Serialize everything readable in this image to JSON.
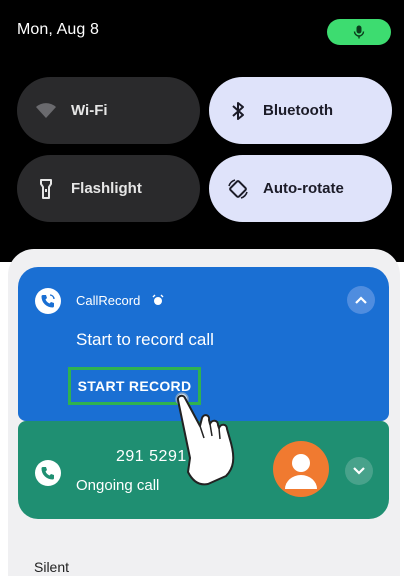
{
  "status": {
    "date": "Mon, Aug 8",
    "mic_icon": "mic-icon",
    "mic_color": "#3ddc70"
  },
  "quick_settings": [
    {
      "label": "Wi-Fi",
      "icon": "wifi-icon",
      "state": "off"
    },
    {
      "label": "Bluetooth",
      "icon": "bluetooth-icon",
      "state": "on"
    },
    {
      "label": "Flashlight",
      "icon": "flashlight-icon",
      "state": "off"
    },
    {
      "label": "Auto-rotate",
      "icon": "auto-rotate-icon",
      "state": "on"
    }
  ],
  "record_notification": {
    "app_name": "CallRecord",
    "title": "Start to record call",
    "action": "START RECORD",
    "color": "#1a6fd3",
    "highlight_color": "#2fb24f"
  },
  "call_notification": {
    "number": "291 5291",
    "status": "Ongoing call",
    "color": "#1f8f72",
    "avatar_color": "#f07a30"
  },
  "section": {
    "silent_label": "Silent"
  }
}
